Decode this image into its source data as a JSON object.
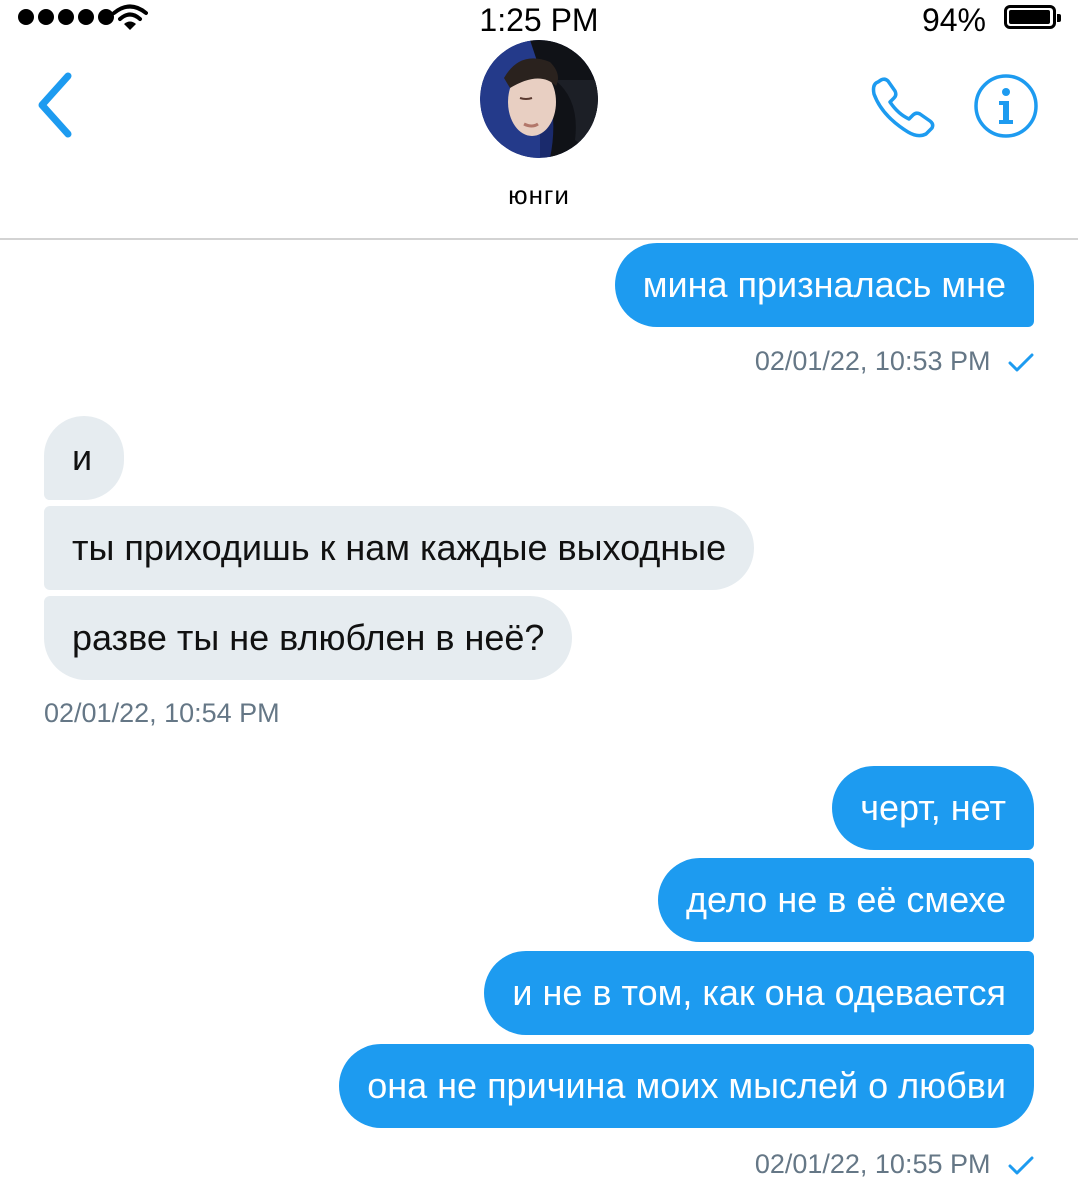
{
  "status_bar": {
    "time": "1:25 PM",
    "battery_percent": "94%",
    "signal_dots": 5,
    "battery_level": 0.94
  },
  "header": {
    "contact_name": "юнги",
    "back_icon": "chevron-left-icon",
    "call_icon": "phone-icon",
    "info_icon": "info-icon",
    "accent_color": "#1d9bf0"
  },
  "messages": [
    {
      "direction": "outgoing",
      "text": "мина призналась мне"
    },
    {
      "direction": "outgoing",
      "timestamp": "02/01/22, 10:53 PM"
    },
    {
      "direction": "incoming",
      "text": "и"
    },
    {
      "direction": "incoming",
      "text": "ты приходишь к нам каждые выходные"
    },
    {
      "direction": "incoming",
      "text": "разве ты не влюблен в неё?"
    },
    {
      "direction": "incoming",
      "timestamp": "02/01/22, 10:54 PM"
    },
    {
      "direction": "outgoing",
      "text": "черт, нет"
    },
    {
      "direction": "outgoing",
      "text": "дело не в её смехе"
    },
    {
      "direction": "outgoing",
      "text": "и не в том, как она одевается"
    },
    {
      "direction": "outgoing",
      "text": "она не причина моих мыслей о любви"
    },
    {
      "direction": "outgoing",
      "timestamp": "02/01/22, 10:55 PM"
    }
  ],
  "colors": {
    "outgoing_bubble": "#1d9bf0",
    "incoming_bubble": "#e6ecf0",
    "timestamp_text": "#657786"
  }
}
